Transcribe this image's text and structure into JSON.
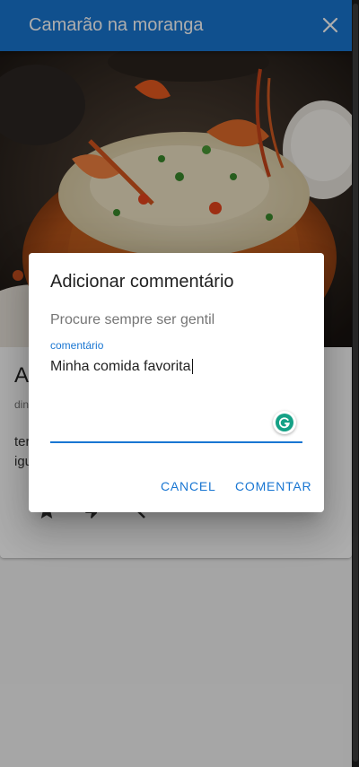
{
  "app_bar": {
    "title": "Camarão na moranga",
    "close_icon": "close-icon",
    "color": "#1976d2"
  },
  "recipe_card": {
    "image_subject": "food-photo",
    "title_partial": "A",
    "subtitle_partial": "din",
    "text_partial": [
      "ter",
      "igu"
    ],
    "action_icons": [
      "star-icon",
      "thumb-down-icon",
      "chevron-icon"
    ]
  },
  "dialog": {
    "title": "Adicionar commentário",
    "text": "Procure sempre ser gentil",
    "field": {
      "label": "comentário",
      "value": "Minha comida favorita"
    },
    "grammarly_icon": "grammarly-icon",
    "buttons": {
      "cancel": "CANCEL",
      "submit": "COMENTAR"
    },
    "accent_color": "#1976d2"
  }
}
